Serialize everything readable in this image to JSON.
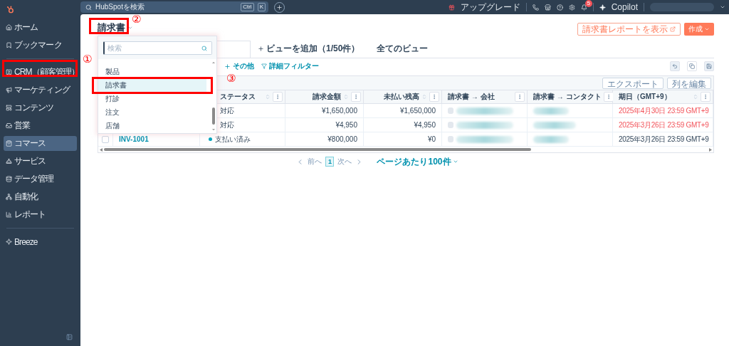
{
  "topbar": {
    "search_placeholder": "HubSpotを検索",
    "shortcut_keys": [
      "Ctrl",
      "K"
    ],
    "upgrade": "アップグレード",
    "notification_count": "5",
    "copilot": "Copilot"
  },
  "sidebar": {
    "groups": [
      [
        {
          "label": "ホーム",
          "selected": false
        },
        {
          "label": "ブックマーク",
          "selected": false
        }
      ],
      [
        {
          "label": "CRM（顧客管理）",
          "selected": false
        },
        {
          "label": "マーケティング",
          "selected": false
        },
        {
          "label": "コンテンツ",
          "selected": false
        },
        {
          "label": "営業",
          "selected": false
        },
        {
          "label": "コマース",
          "selected": true
        },
        {
          "label": "サービス",
          "selected": false
        },
        {
          "label": "データ管理",
          "selected": false
        },
        {
          "label": "自動化",
          "selected": false
        },
        {
          "label": "レポート",
          "selected": false
        }
      ],
      [
        {
          "label": "Breeze",
          "selected": false
        }
      ]
    ]
  },
  "header": {
    "title": "請求書",
    "report_button": "請求書レポートを表示",
    "create_button": "作成"
  },
  "views": {
    "add_view": "ビューを追加（1/50件）",
    "all_views": "全てのビュー"
  },
  "filters": {
    "more": "その他",
    "advanced": "詳細フィルター"
  },
  "table": {
    "actions": [
      "エクスポート",
      "列を編集"
    ],
    "columns": [
      {
        "label": "ステータス",
        "sortable": true
      },
      {
        "label": "請求金額",
        "sortable": true
      },
      {
        "label": "未払い残高",
        "sortable": true
      },
      {
        "label": "請求書 → 会社",
        "sortable": false
      },
      {
        "label": "請求書 → コンタクト",
        "sortable": false
      },
      {
        "label": "期日（GMT+9）",
        "sortable": true
      }
    ],
    "rows": [
      {
        "status": "対応",
        "amount": "¥1,650,000",
        "balance": "¥1,650,000",
        "due": "2025年4月30日 23:59 GMT+9",
        "overdue": true
      },
      {
        "status": "対応",
        "amount": "¥4,950",
        "balance": "¥4,950",
        "due": "2025年3月26日 23:59 GMT+9",
        "overdue": true
      },
      {
        "checked": false,
        "name": "INV-1001",
        "status": "支払い済み",
        "color": "#00a4bd",
        "amount": "¥800,000",
        "balance": "¥0",
        "due": "2025年3月26日 23:59 GMT+9",
        "overdue": false
      }
    ]
  },
  "dropdown": {
    "placeholder": "検索",
    "items": [
      {
        "label": "製品",
        "selected": false
      },
      {
        "label": "請求書",
        "selected": true
      },
      {
        "label": "打診",
        "selected": false
      },
      {
        "label": "注文",
        "selected": false
      },
      {
        "label": "店舗",
        "selected": false
      }
    ]
  },
  "pagination": {
    "prev": "前へ",
    "page": "1",
    "next": "次へ",
    "per_page": "ページあたり100件"
  },
  "annotations": [
    {
      "number": "①"
    },
    {
      "number": "②"
    },
    {
      "number": "③"
    }
  ]
}
